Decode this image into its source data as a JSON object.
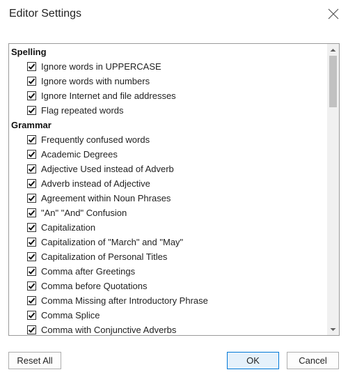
{
  "dialog": {
    "title": "Editor Settings"
  },
  "sections": [
    {
      "header": "Spelling",
      "items": [
        {
          "label": "Ignore words in UPPERCASE",
          "checked": true
        },
        {
          "label": "Ignore words with numbers",
          "checked": true
        },
        {
          "label": "Ignore Internet and file addresses",
          "checked": true
        },
        {
          "label": "Flag repeated words",
          "checked": true
        }
      ]
    },
    {
      "header": "Grammar",
      "items": [
        {
          "label": "Frequently confused words",
          "checked": true
        },
        {
          "label": "Academic Degrees",
          "checked": true
        },
        {
          "label": "Adjective Used instead of Adverb",
          "checked": true
        },
        {
          "label": "Adverb instead of Adjective",
          "checked": true
        },
        {
          "label": "Agreement within Noun Phrases",
          "checked": true
        },
        {
          "label": "\"An\" \"And\" Confusion",
          "checked": true
        },
        {
          "label": "Capitalization",
          "checked": true
        },
        {
          "label": "Capitalization of \"March\" and \"May\"",
          "checked": true
        },
        {
          "label": "Capitalization of Personal Titles",
          "checked": true
        },
        {
          "label": "Comma after Greetings",
          "checked": true
        },
        {
          "label": "Comma before Quotations",
          "checked": true
        },
        {
          "label": "Comma Missing after Introductory Phrase",
          "checked": true
        },
        {
          "label": "Comma Splice",
          "checked": true
        },
        {
          "label": "Comma with Conjunctive Adverbs",
          "checked": true
        }
      ]
    }
  ],
  "buttons": {
    "reset": "Reset All",
    "ok": "OK",
    "cancel": "Cancel"
  },
  "icons": {
    "close": "close-icon",
    "checkmark": "checkmark-icon",
    "scroll_up": "chevron-up-icon",
    "scroll_down": "chevron-down-icon"
  },
  "colors": {
    "ok_border": "#0078d7",
    "ok_background": "#e5f1fb"
  }
}
